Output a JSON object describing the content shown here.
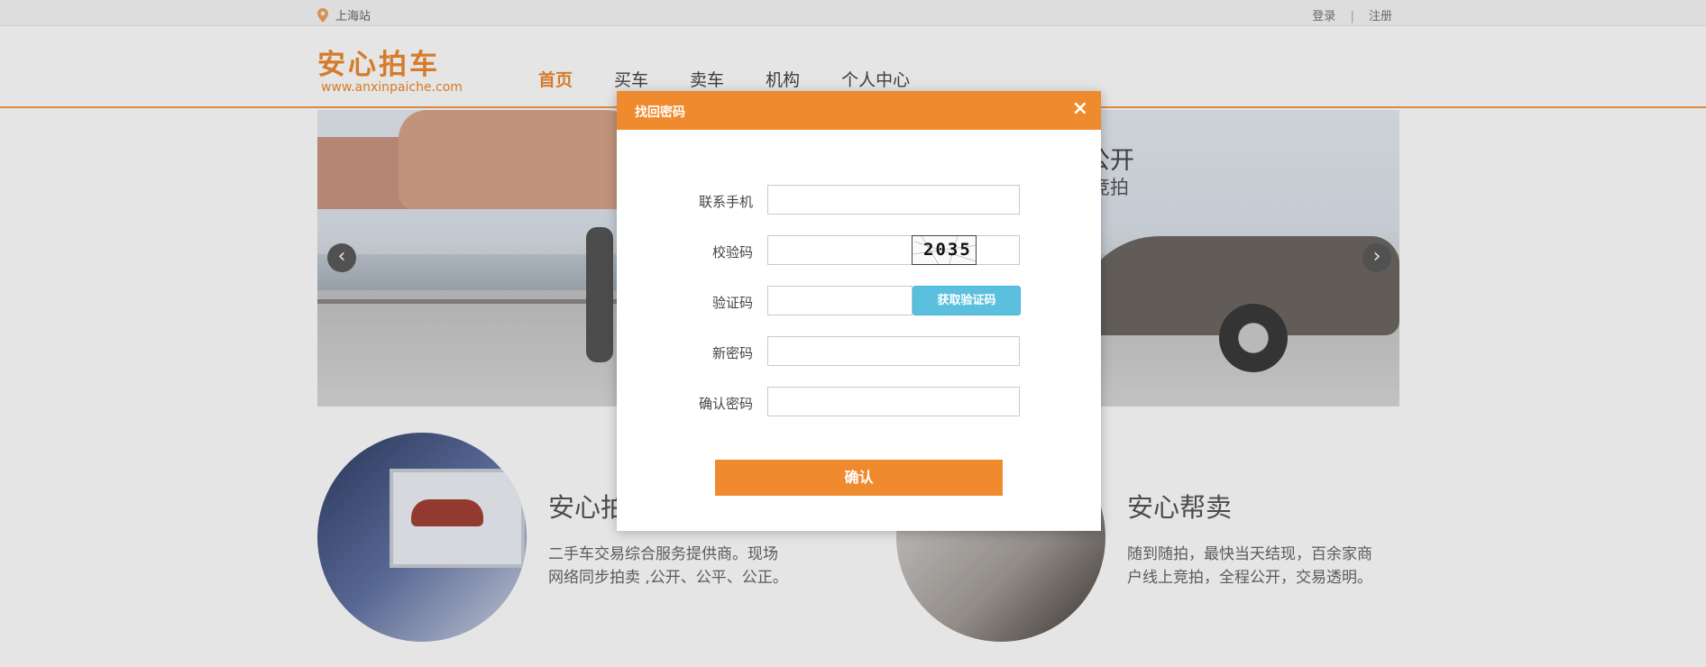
{
  "topbar": {
    "city": "上海站",
    "login": "登录",
    "separator": "|",
    "register": "注册"
  },
  "header": {
    "logo_text": "安心拍车",
    "logo_url": "www.anxinpaiche.com",
    "nav": [
      {
        "label": "首页",
        "active": true
      },
      {
        "label": "买车",
        "active": false
      },
      {
        "label": "卖车",
        "active": false
      },
      {
        "label": "机构",
        "active": false
      },
      {
        "label": "个人中心",
        "active": false
      }
    ]
  },
  "banner": {
    "text_line1": "公开",
    "text_line2": "竞拍",
    "prev_glyph": "‹",
    "next_glyph": "›"
  },
  "features": [
    {
      "title": "安心拍",
      "desc_line1": "二手车交易综合服务提供商。现场",
      "desc_line2": "网络同步拍卖 ,公开、公平、公正。"
    },
    {
      "title": "安心帮卖",
      "desc_line1": "随到随拍，最快当天结现，百余家商",
      "desc_line2": "户线上竞拍，全程公开，交易透明。"
    }
  ],
  "modal": {
    "title": "找回密码",
    "close_glyph": "×",
    "fields": {
      "phone_label": "联系手机",
      "captcha_label": "校验码",
      "captcha_code": "2035",
      "sms_label": "验证码",
      "sms_button": "获取验证码",
      "new_password_label": "新密码",
      "confirm_password_label": "确认密码"
    },
    "confirm_button": "确认"
  },
  "colors": {
    "accent": "#ef8a2e",
    "sms_button": "#5bc0de"
  }
}
